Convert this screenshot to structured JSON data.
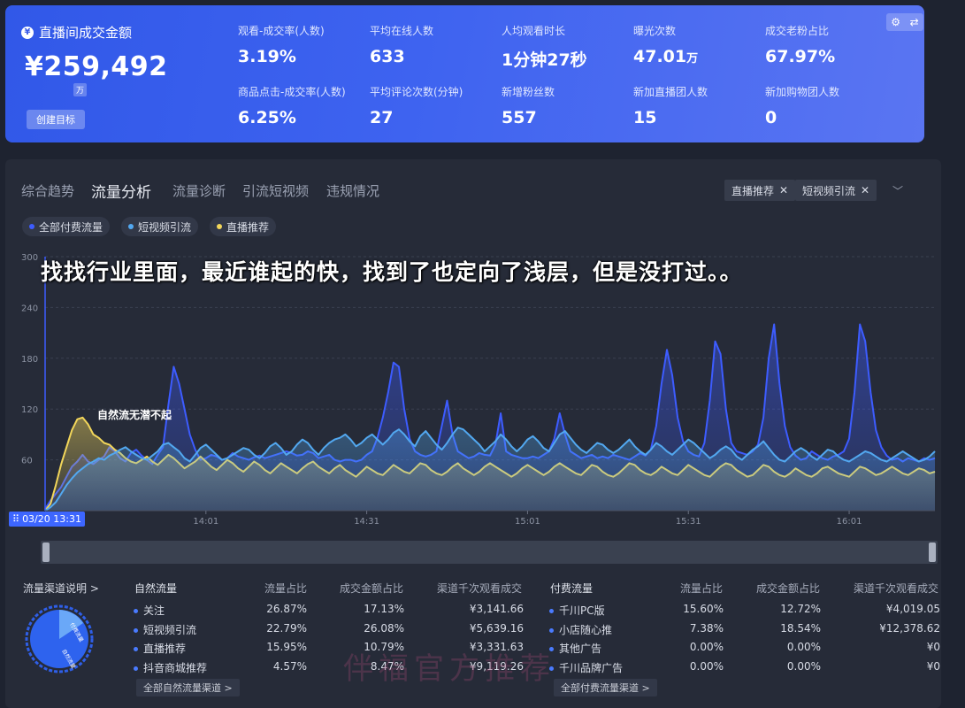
{
  "summary": {
    "title": "直播间成交金额",
    "title_icon": "yen-icon",
    "gmv_value": "¥259,492",
    "gmv_unit": "万",
    "create_target_label": "创建目标",
    "metrics": [
      {
        "label": "观看-成交率(人数)",
        "value": "3.19%"
      },
      {
        "label": "平均在线人数",
        "value": "633"
      },
      {
        "label": "人均观看时长",
        "value": "1分钟27秒"
      },
      {
        "label": "曝光次数",
        "value": "47.01",
        "unit": "万"
      },
      {
        "label": "成交老粉占比",
        "value": "67.97%"
      },
      {
        "label": "商品点击-成交率(人数)",
        "value": "6.25%"
      },
      {
        "label": "平均评论次数(分钟)",
        "value": "27"
      },
      {
        "label": "新增粉丝数",
        "value": "557"
      },
      {
        "label": "新加直播团人数",
        "value": "15"
      },
      {
        "label": "新加购物团人数",
        "value": "0"
      }
    ],
    "tool_icons": [
      "gear-icon",
      "swap-icon"
    ]
  },
  "tabs": [
    {
      "label": "综合趋势",
      "active": false
    },
    {
      "label": "流量分析",
      "active": true
    },
    {
      "label": "流量诊断",
      "active": false
    },
    {
      "label": "引流短视频",
      "active": false
    },
    {
      "label": "违规情况",
      "active": false
    }
  ],
  "filters": [
    {
      "label": "直播推荐"
    },
    {
      "label": "短视频引流"
    }
  ],
  "legend": [
    {
      "label": "全部付费流量",
      "color": "#3d5cff"
    },
    {
      "label": "短视频引流",
      "color": "#52a8f0"
    },
    {
      "label": "直播推荐",
      "color": "#f2d65a"
    }
  ],
  "caption": "找找行业里面，最近谁起的快，找到了也定向了浅层，但是没打过。。",
  "annotation": "自然流无潜不起",
  "time_start": "03/20 13:31",
  "chart_data": {
    "type": "area",
    "y_ticks": [
      "300",
      "240",
      "180",
      "120",
      "60"
    ],
    "ylim": [
      0,
      300
    ],
    "x_ticks": [
      "14:01",
      "14:31",
      "15:01",
      "15:31",
      "16:01"
    ],
    "x_tick_indices": [
      30,
      60,
      90,
      120,
      150
    ],
    "x_count": 167,
    "grid": true,
    "series": [
      {
        "name": "全部付费流量",
        "color": "#3d5cff",
        "values": [
          2,
          12,
          20,
          28,
          40,
          52,
          58,
          66,
          58,
          55,
          60,
          64,
          75,
          70,
          62,
          58,
          68,
          72,
          65,
          60,
          55,
          66,
          75,
          125,
          170,
          150,
          120,
          90,
          72,
          60,
          62,
          66,
          64,
          60,
          62,
          68,
          64,
          62,
          60,
          63,
          65,
          62,
          64,
          66,
          68,
          70,
          68,
          65,
          66,
          70,
          68,
          62,
          64,
          66,
          60,
          58,
          60,
          60,
          58,
          60,
          66,
          70,
          86,
          110,
          140,
          175,
          170,
          120,
          85,
          70,
          66,
          64,
          66,
          70,
          100,
          130,
          90,
          70,
          66,
          62,
          64,
          68,
          66,
          65,
          78,
          115,
          70,
          66,
          64,
          62,
          62,
          64,
          62,
          66,
          70,
          85,
          115,
          90,
          70,
          66,
          62,
          64,
          66,
          62,
          64,
          62,
          66,
          64,
          62,
          60,
          64,
          68,
          65,
          72,
          100,
          150,
          190,
          160,
          110,
          82,
          70,
          66,
          64,
          80,
          130,
          200,
          185,
          120,
          80,
          70,
          68,
          66,
          70,
          78,
          110,
          180,
          220,
          150,
          100,
          75,
          65,
          60,
          62,
          70,
          66,
          62,
          60,
          64,
          66,
          70,
          85,
          140,
          220,
          200,
          140,
          95,
          75,
          65,
          60,
          62,
          58,
          62,
          60,
          58,
          62,
          60,
          62
        ]
      },
      {
        "name": "短视频引流",
        "color": "#52a8f0",
        "values": [
          0,
          4,
          10,
          20,
          30,
          38,
          45,
          50,
          55,
          58,
          62,
          60,
          65,
          68,
          72,
          75,
          70,
          66,
          62,
          60,
          65,
          70,
          78,
          80,
          75,
          70,
          62,
          58,
          66,
          74,
          78,
          72,
          66,
          60,
          62,
          66,
          70,
          74,
          72,
          66,
          62,
          68,
          76,
          80,
          74,
          66,
          70,
          78,
          84,
          80,
          72,
          66,
          74,
          80,
          84,
          86,
          90,
          84,
          76,
          80,
          86,
          90,
          84,
          78,
          84,
          92,
          96,
          90,
          82,
          76,
          88,
          94,
          86,
          78,
          72,
          80,
          90,
          98,
          96,
          90,
          84,
          78,
          70,
          76,
          82,
          90,
          84,
          76,
          70,
          76,
          84,
          88,
          82,
          74,
          70,
          80,
          90,
          94,
          86,
          78,
          72,
          68,
          74,
          80,
          78,
          72,
          68,
          72,
          78,
          84,
          76,
          70,
          66,
          72,
          80,
          76,
          70,
          66,
          72,
          78,
          84,
          80,
          74,
          68,
          62,
          66,
          72,
          76,
          72,
          64,
          60,
          66,
          72,
          76,
          82,
          74,
          66,
          60,
          58,
          64,
          70,
          74,
          70,
          64,
          60,
          66,
          72,
          70,
          64,
          60,
          58,
          62,
          66,
          70,
          68,
          64,
          60,
          58,
          62,
          66,
          70,
          66,
          62,
          58,
          60,
          64,
          70
        ]
      },
      {
        "name": "直播推荐",
        "color": "#f2d65a",
        "values": [
          0,
          8,
          30,
          55,
          75,
          95,
          108,
          110,
          102,
          90,
          86,
          80,
          78,
          72,
          68,
          62,
          58,
          56,
          60,
          64,
          58,
          54,
          60,
          66,
          62,
          56,
          50,
          54,
          58,
          64,
          58,
          52,
          48,
          54,
          60,
          56,
          50,
          46,
          52,
          58,
          54,
          48,
          44,
          50,
          56,
          52,
          48,
          44,
          50,
          55,
          58,
          52,
          48,
          44,
          50,
          54,
          48,
          44,
          40,
          46,
          52,
          48,
          44,
          42,
          48,
          54,
          50,
          46,
          44,
          50,
          56,
          54,
          48,
          44,
          42,
          46,
          52,
          56,
          50,
          46,
          42,
          46,
          52,
          56,
          52,
          48,
          44,
          40,
          44,
          50,
          54,
          50,
          46,
          42,
          46,
          52,
          56,
          52,
          48,
          44,
          42,
          48,
          54,
          52,
          46,
          42,
          40,
          44,
          50,
          56,
          54,
          48,
          44,
          42,
          46,
          52,
          48,
          44,
          42,
          48,
          54,
          50,
          46,
          42,
          40,
          46,
          52,
          56,
          54,
          48,
          44,
          40,
          42,
          48,
          54,
          52,
          46,
          42,
          40,
          44,
          50,
          46,
          42,
          40,
          44,
          50,
          52,
          48,
          44,
          42,
          40,
          46,
          52,
          50,
          46,
          42,
          44,
          48,
          52,
          48,
          44,
          42,
          46,
          50,
          48,
          44,
          46
        ]
      }
    ]
  },
  "channel": {
    "title": "流量渠道说明",
    "donut_labels": [
      "付费流量",
      "自然流量"
    ],
    "natural": {
      "title": "自然流量",
      "headers": [
        "流量占比",
        "成交金额占比",
        "渠道千次观看成交"
      ],
      "rows": [
        {
          "name": "关注",
          "share": "26.87%",
          "gmv_share": "17.13%",
          "per_k": "¥3,141.66"
        },
        {
          "name": "短视频引流",
          "share": "22.79%",
          "gmv_share": "26.08%",
          "per_k": "¥5,639.16"
        },
        {
          "name": "直播推荐",
          "share": "15.95%",
          "gmv_share": "10.79%",
          "per_k": "¥3,331.63"
        },
        {
          "name": "抖音商城推荐",
          "share": "4.57%",
          "gmv_share": "8.47%",
          "per_k": "¥9,119.26"
        }
      ],
      "see_all": "全部自然流量渠道 >"
    },
    "paid": {
      "title": "付费流量",
      "headers": [
        "流量占比",
        "成交金额占比",
        "渠道千次观看成交"
      ],
      "rows": [
        {
          "name": "千川PC版",
          "share": "15.60%",
          "gmv_share": "12.72%",
          "per_k": "¥4,019.05"
        },
        {
          "name": "小店随心推",
          "share": "7.38%",
          "gmv_share": "18.54%",
          "per_k": "¥12,378.62"
        },
        {
          "name": "其他广告",
          "share": "0.00%",
          "gmv_share": "0.00%",
          "per_k": "¥0"
        },
        {
          "name": "千川品牌广告",
          "share": "0.00%",
          "gmv_share": "0.00%",
          "per_k": "¥0"
        }
      ],
      "see_all": "全部付费流量渠道 >"
    }
  },
  "watermark": "伴福官方推荐"
}
